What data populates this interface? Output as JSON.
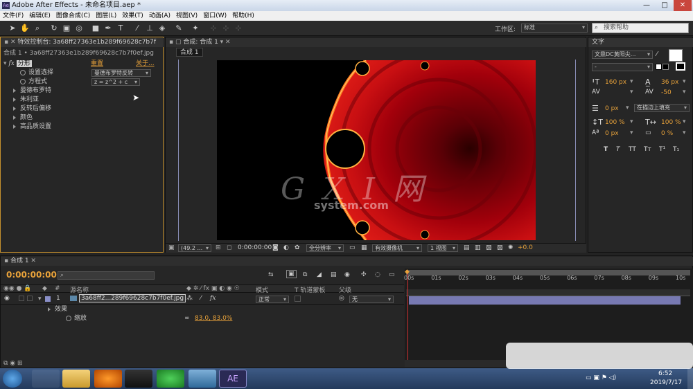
{
  "window": {
    "title": "Adobe After Effects - 未命名项目.aep *",
    "app_badge": "Ae",
    "min": "—",
    "max": "□",
    "close": "✕"
  },
  "menu": [
    "文件(F)",
    "编辑(E)",
    "图像合成(C)",
    "图层(L)",
    "效果(T)",
    "动画(A)",
    "视图(V)",
    "窗口(W)",
    "帮助(H)"
  ],
  "toolbar": {
    "workspace_label": "工作区:",
    "workspace_value": "标准",
    "search_placeholder": "搜索帮助"
  },
  "effects_panel": {
    "tab": "特效控制台: 3a68ff27363e1b289f69628c7b7f",
    "sub": "合成 1 • 3a68ff27363e1b289f69628c7b7f0ef.jpg",
    "effect_name": "分形",
    "reset": "重置",
    "about": "关于...",
    "prop1_label": "设置选择",
    "prop1_value": "曼德布罗特反转",
    "prop2_label": "方程式",
    "prop2_value": "z = z^2 + c",
    "groups": [
      "曼德布罗特",
      "朱利亚",
      "反转后偏移",
      "颜色",
      "高品质设置"
    ]
  },
  "comp_panel": {
    "tab": "合成: 合成 1",
    "sub_tab": "合成 1",
    "zoom": "(49.2 ...",
    "timecode": "0:00:00:00",
    "resolution": "全分辨率",
    "camera": "有效摄像机",
    "views": "1 视图",
    "exposure": "+0.0"
  },
  "watermark": {
    "line1": "G X I 网",
    "line2": "system.com"
  },
  "text_panel": {
    "tab": "文字",
    "font": "文鼎DC黄阳尖...",
    "style": "-",
    "size": "160 px",
    "leading": "36 px",
    "tracking": "-50",
    "kerning": "",
    "indent": "0 px",
    "stroke_mode": "在描边上填充",
    "vscale": "100 %",
    "hscale": "100 %",
    "baseline": "0 px",
    "tsume": "0 %",
    "styles": [
      "T",
      "T",
      "TT",
      "Tт",
      "T¹",
      "T₁"
    ]
  },
  "timeline": {
    "tab": "合成 1",
    "timecode": "0:00:00:00",
    "headers": {
      "layer_name": "源名称",
      "mode": "模式",
      "trkmat": "T  轨道蒙板",
      "parent": "父级"
    },
    "layer": {
      "num": "1",
      "name": "3a68ff2...289f69628c7b7f0ef.jpg",
      "mode": "正常",
      "parent": "无"
    },
    "effects_label": "效果",
    "scale_label": "缩放",
    "scale_value": "83.0, 83.0%",
    "ruler": [
      "00s",
      "01s",
      "02s",
      "03s",
      "04s",
      "05s",
      "06s",
      "07s",
      "08s",
      "09s",
      "10s"
    ]
  },
  "taskbar": {
    "time": "6:52",
    "date": "2019/7/17",
    "ae_label": "AE"
  }
}
